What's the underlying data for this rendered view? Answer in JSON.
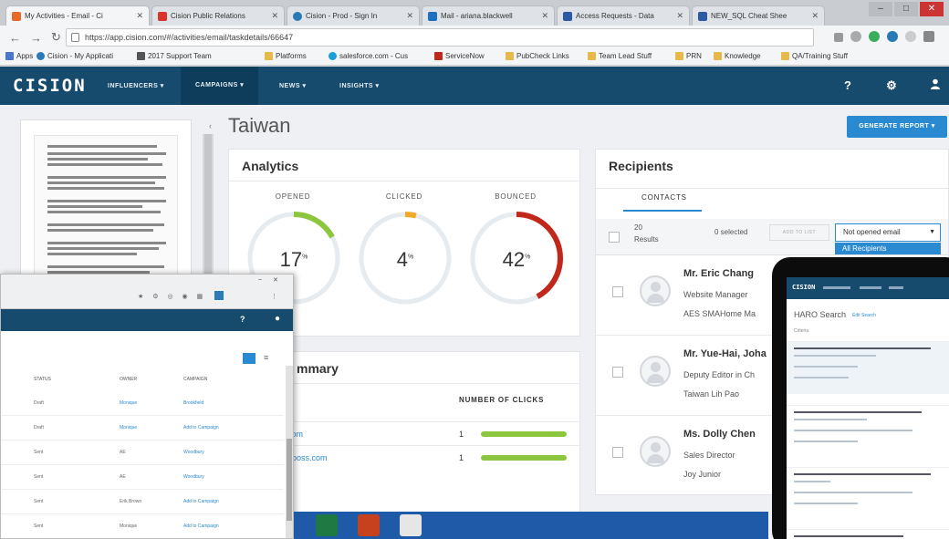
{
  "browser": {
    "tabs": [
      "My Activities - Email - Ci",
      "Cision Public Relations",
      "Cision - Prod - Sign In",
      "Mail - ariana.blackwell",
      "Access Requests - Data",
      "NEW_SQL Cheat Shee"
    ],
    "url": "https://app.cision.com/#/activities/email/taskdetails/66647",
    "bookmarks": [
      "Apps",
      "Cision - My Applicati",
      "2017 Support Team",
      "Platforms",
      "salesforce.com - Cus",
      "ServiceNow",
      "PubCheck Links",
      "Team Lead Stuff",
      "PRN",
      "Knowledge",
      "QA/Training Stuff"
    ]
  },
  "nav": {
    "logo": "CISION",
    "items": [
      "INFLUENCERS ▾",
      "CAMPAIGNS ▾",
      "NEWS ▾",
      "INSIGHTS ▾"
    ],
    "help": "?"
  },
  "page": {
    "title": "Taiwan",
    "generate_report": "GENERATE REPORT ▾"
  },
  "analytics": {
    "title": "Analytics",
    "metrics": [
      {
        "label": "OPENED",
        "value": "17",
        "unit": "%",
        "pct": 17,
        "color": "#8cc63f"
      },
      {
        "label": "CLICKED",
        "value": "4",
        "unit": "%",
        "pct": 4,
        "color": "#f0a92b"
      },
      {
        "label": "BOUNCED",
        "value": "42",
        "unit": "%",
        "pct": 42,
        "color": "#c0281b"
      }
    ]
  },
  "summary": {
    "title": "mmary",
    "column": "NUMBER OF CLICKS",
    "rows": [
      {
        "link": "com",
        "clicks": "1"
      },
      {
        "link": "oboss.com",
        "clicks": "1"
      }
    ]
  },
  "recipients": {
    "title": "Recipients",
    "tab": "CONTACTS",
    "count": "20",
    "results_label": "Results",
    "selected": "0 selected",
    "add_to_list": "ADD TO LIST",
    "filter": "Not opened email",
    "dropdown_option": "All Recipients",
    "contacts": [
      {
        "name": "Mr. Eric Chang",
        "title": "Website Manager",
        "org": "AES SMAHome Ma"
      },
      {
        "name": "Mr. Yue-Hai, Joha",
        "title": "Deputy Editor in Ch",
        "org": "Taiwan Lih Pao"
      },
      {
        "name": "Ms. Dolly Chen",
        "title": "Sales Director",
        "org": "Joy Junior"
      }
    ]
  },
  "overlay": {
    "headers": [
      "STATUS",
      "OWNER",
      "CAMPAIGN"
    ],
    "rows": [
      [
        "Draft",
        "Monique",
        "Brookfield"
      ],
      [
        "Draft",
        "Monique",
        "Add to Campaign"
      ],
      [
        "Sent",
        "AE",
        "Woodbury"
      ],
      [
        "Sent",
        "AE",
        "Woodbury"
      ],
      [
        "Sent",
        "Erik Brown",
        "Add to Campaign"
      ],
      [
        "Sent",
        "Monique",
        "Add to Campaign"
      ]
    ]
  },
  "tablet": {
    "logo": "CISION",
    "title": "HARO Search",
    "subtitle": "Edit Search",
    "criteria": "Criteria"
  }
}
